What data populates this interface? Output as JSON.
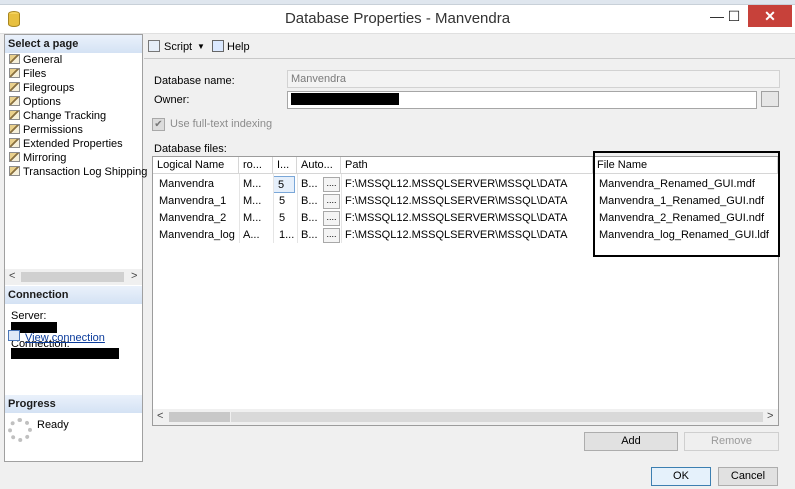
{
  "window": {
    "title": "Database Properties - Manvendra",
    "minimize_glyph": "—",
    "maximize_glyph": "☐",
    "close_glyph": "✕"
  },
  "left": {
    "select_page_header": "Select a page",
    "pages": [
      {
        "label": "General"
      },
      {
        "label": "Files"
      },
      {
        "label": "Filegroups"
      },
      {
        "label": "Options"
      },
      {
        "label": "Change Tracking"
      },
      {
        "label": "Permissions"
      },
      {
        "label": "Extended Properties"
      },
      {
        "label": "Mirroring"
      },
      {
        "label": "Transaction Log Shipping"
      }
    ],
    "scroll_left": "<",
    "scroll_right": ">",
    "connection_header": "Connection",
    "server_label": "Server:",
    "connection_label": "Connection:",
    "view_connection_link": "View connection",
    "progress_header": "Progress",
    "progress_status": "Ready"
  },
  "toolbar": {
    "script_label": "Script",
    "script_dropdown": "▼",
    "help_label": "Help"
  },
  "form": {
    "db_name_label": "Database name:",
    "db_name_value": "Manvendra",
    "owner_label": "Owner:",
    "fulltext_label": "Use full-text indexing",
    "fulltext_checked": "✔",
    "db_files_label": "Database files:"
  },
  "grid": {
    "headers": [
      "Logical Name",
      "ro...",
      "I...",
      "Auto...",
      "Path",
      "File Name"
    ],
    "rows": [
      [
        "Manvendra",
        "M...",
        "5",
        "B...",
        "F:\\MSSQL12.MSSQLSERVER\\MSSQL\\DATA",
        "Manvendra_Renamed_GUI.mdf"
      ],
      [
        "Manvendra_1",
        "M...",
        "5",
        "B...",
        "F:\\MSSQL12.MSSQLSERVER\\MSSQL\\DATA",
        "Manvendra_1_Renamed_GUI.ndf"
      ],
      [
        "Manvendra_2",
        "M...",
        "5",
        "B...",
        "F:\\MSSQL12.MSSQLSERVER\\MSSQL\\DATA",
        "Manvendra_2_Renamed_GUI.ndf"
      ],
      [
        "Manvendra_log",
        "A...",
        "1...",
        "B...",
        "F:\\MSSQL12.MSSQLSERVER\\MSSQL\\DATA",
        "Manvendra_log_Renamed_GUI.ldf"
      ]
    ],
    "ellipsis": "...."
  },
  "buttons": {
    "add": "Add",
    "remove": "Remove",
    "ok": "OK",
    "cancel": "Cancel"
  },
  "colors": {
    "close_button": "#c7413a",
    "link": "#0a3b9c"
  }
}
